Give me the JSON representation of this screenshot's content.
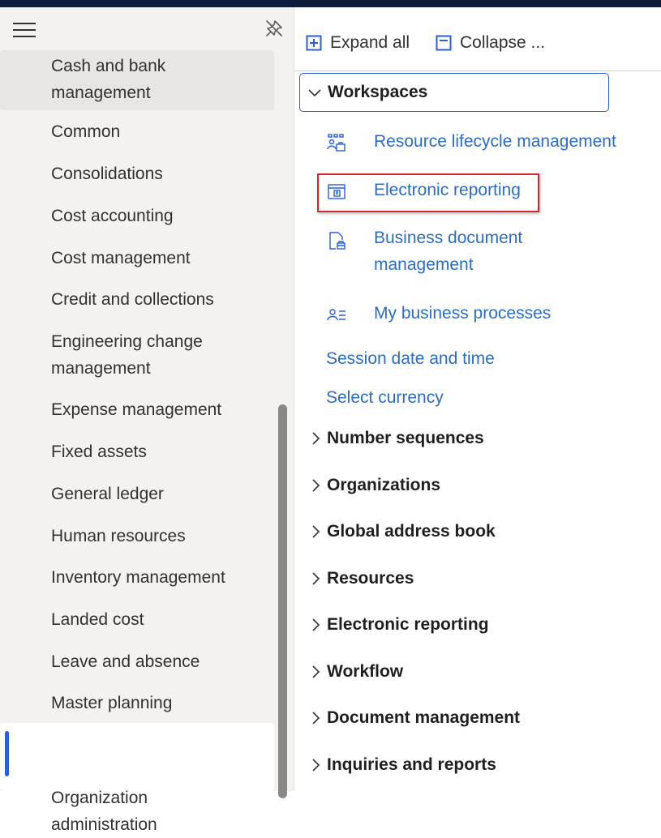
{
  "sidebar": {
    "menu_icon": "hamburger-icon",
    "pin_icon": "pin-icon",
    "items": [
      {
        "label": "Cash and bank\nmanagement"
      },
      {
        "label": "Common"
      },
      {
        "label": "Consolidations"
      },
      {
        "label": "Cost accounting"
      },
      {
        "label": "Cost management"
      },
      {
        "label": "Credit and collections"
      },
      {
        "label": "Engineering change\nmanagement"
      },
      {
        "label": "Expense management"
      },
      {
        "label": "Fixed assets"
      },
      {
        "label": "General ledger"
      },
      {
        "label": "Human resources"
      },
      {
        "label": "Inventory management"
      },
      {
        "label": "Landed cost"
      },
      {
        "label": "Leave and absence"
      },
      {
        "label": "Master planning"
      },
      {
        "label": "Organization\nadministration"
      }
    ],
    "selected_index": 15
  },
  "toolbar": {
    "expand_label": "Expand all",
    "collapse_label": "Collapse ..."
  },
  "workspaces": {
    "label": "Workspaces",
    "links": [
      {
        "label": "Resource lifecycle management",
        "icon": "resource-lifecycle-icon"
      },
      {
        "label": "Electronic reporting",
        "icon": "electronic-reporting-icon"
      },
      {
        "label": "Business document\nmanagement",
        "icon": "business-document-icon"
      },
      {
        "label": "My business processes",
        "icon": "business-processes-icon"
      }
    ]
  },
  "links": {
    "session": "Session date and time",
    "currency": "Select currency"
  },
  "sections": [
    {
      "label": "Number sequences"
    },
    {
      "label": "Organizations"
    },
    {
      "label": "Global address book"
    },
    {
      "label": "Resources"
    },
    {
      "label": "Electronic reporting"
    },
    {
      "label": "Workflow"
    },
    {
      "label": "Document management"
    },
    {
      "label": "Inquiries and reports"
    }
  ],
  "colors": {
    "accent": "#2b5ed8",
    "link": "#2b6cc4",
    "highlight": "#d9262c",
    "topbar": "#0f1b3a",
    "sidebar_bg": "#f3f2f1"
  }
}
